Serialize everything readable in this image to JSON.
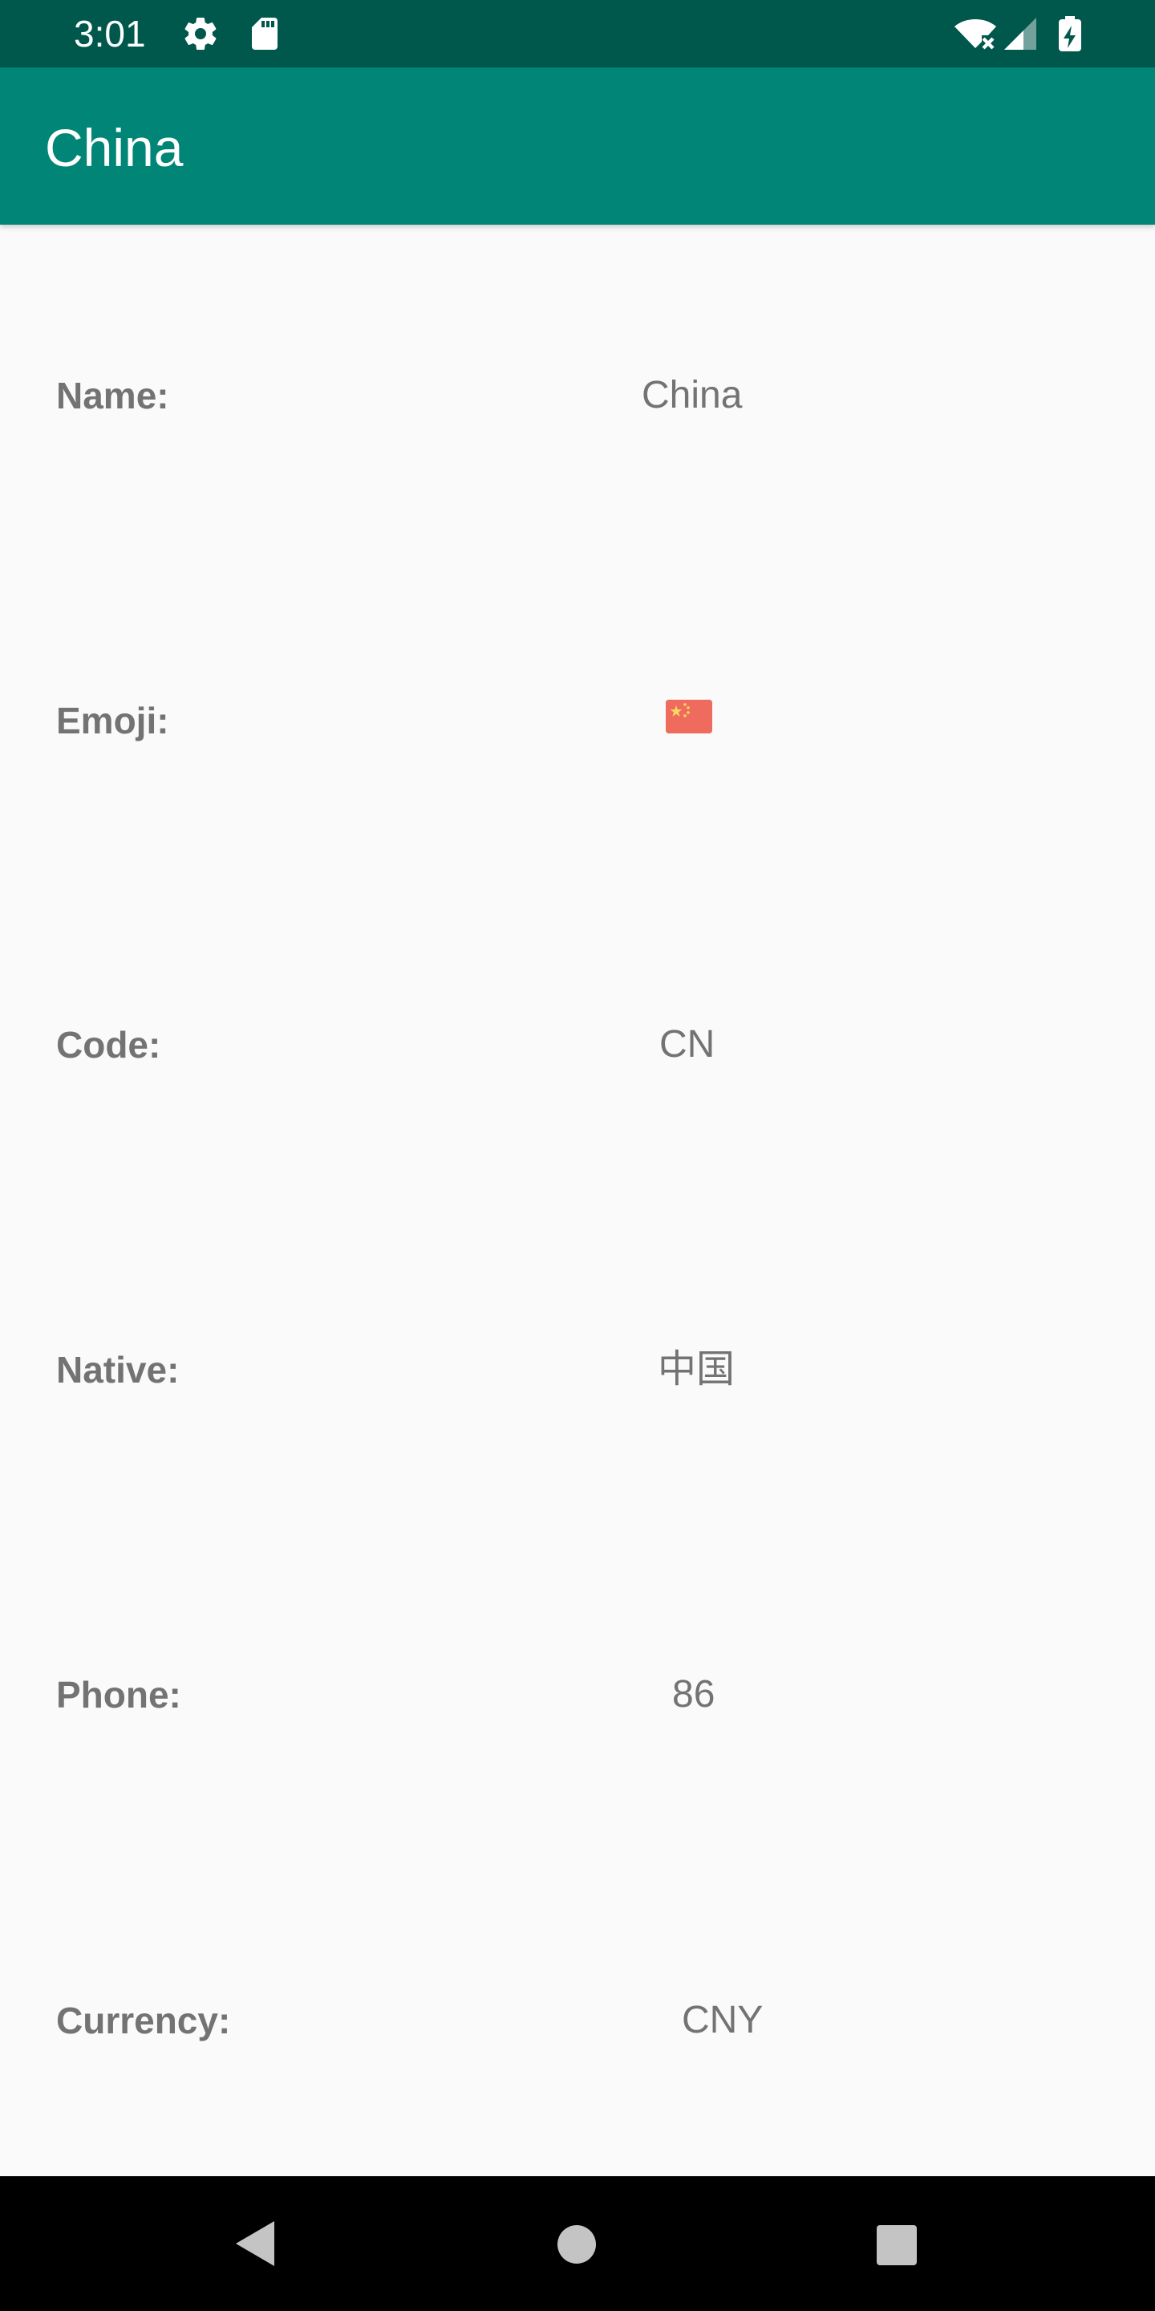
{
  "status_bar": {
    "time": "3:01",
    "icons": [
      "gear-icon",
      "sd-card-icon",
      "wifi-off-icon",
      "cell-signal-icon",
      "battery-charging-icon"
    ]
  },
  "app_bar": {
    "title": "China",
    "color": "#008577",
    "status_color": "#00574b"
  },
  "details": {
    "name_label": "Name:",
    "name_value": "China",
    "emoji_label": "Emoji:",
    "emoji_value": "🇨🇳",
    "code_label": "Code:",
    "code_value": "CN",
    "native_label": "Native:",
    "native_value": "中国",
    "phone_label": "Phone:",
    "phone_value": "86",
    "currency_label": "Currency:",
    "currency_value": "CNY"
  },
  "nav_bar": {
    "icons": [
      "back-icon",
      "home-icon",
      "recents-icon"
    ]
  }
}
